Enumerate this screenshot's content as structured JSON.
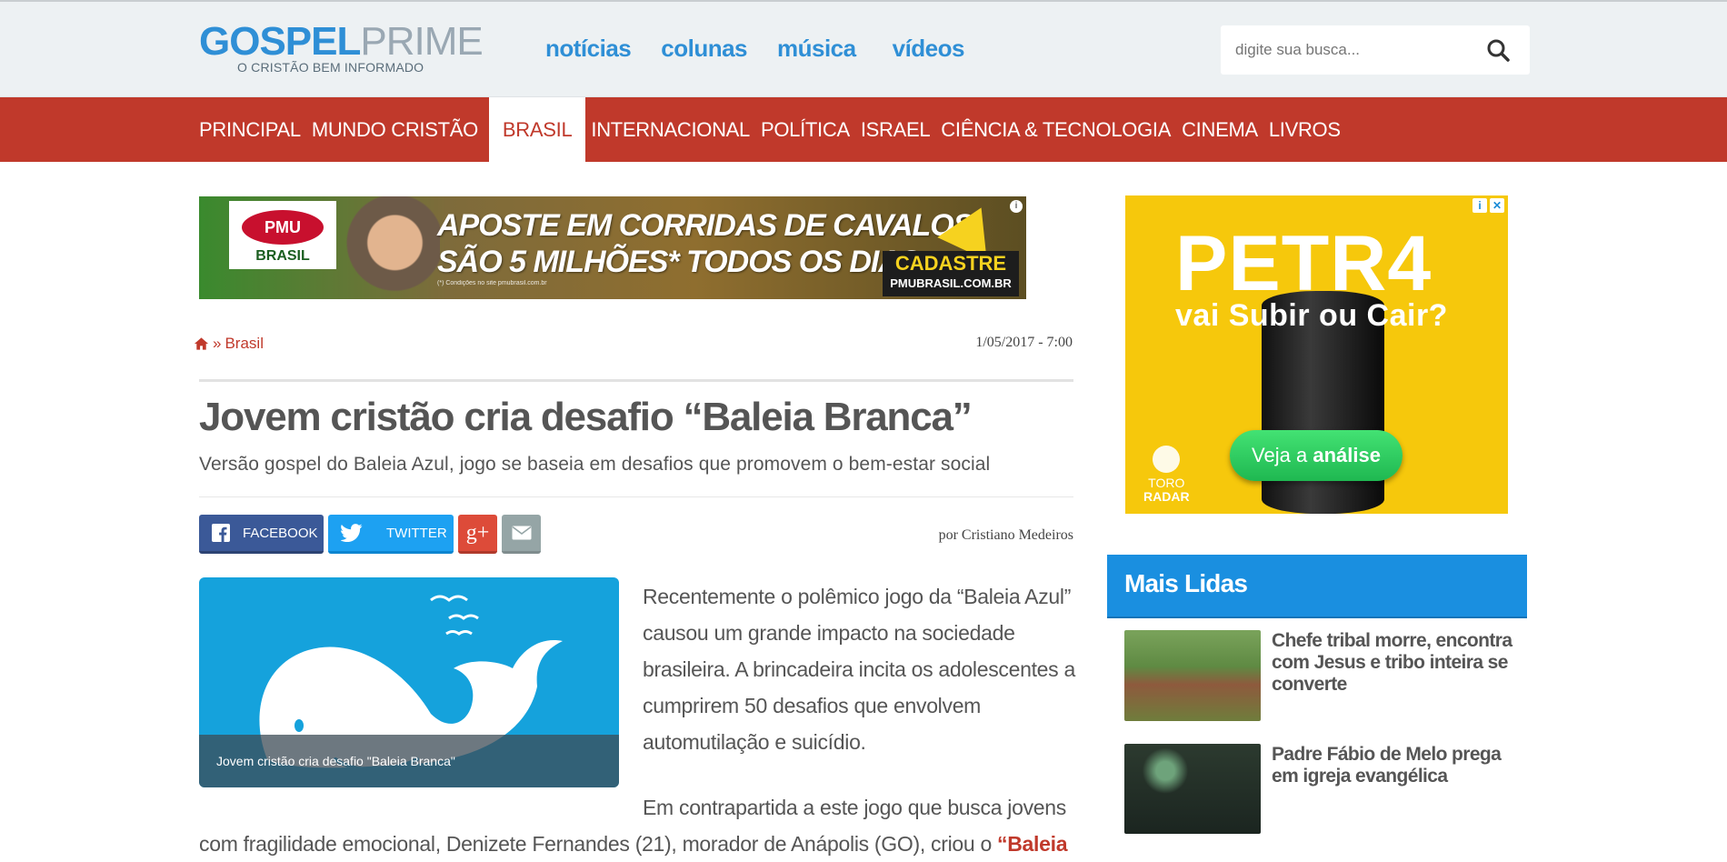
{
  "header": {
    "logo": {
      "word1": "GOSPEL",
      "word2": "PRIME",
      "tagline": "O CRISTÃO BEM INFORMADO"
    },
    "nav": [
      "notícias",
      "colunas",
      "música",
      "vídeos"
    ],
    "search": {
      "placeholder": "digite sua busca..."
    }
  },
  "categories": {
    "items": [
      "PRINCIPAL",
      "MUNDO CRISTÃO",
      "BRASIL",
      "INTERNACIONAL",
      "POLÍTICA",
      "ISRAEL",
      "CIÊNCIA & TECNOLOGIA",
      "CINEMA",
      "LIVROS"
    ],
    "active": "BRASIL"
  },
  "ad_top": {
    "brand": "PMU",
    "country": "BRASIL",
    "headline_line1": "APOSTE EM CORRIDAS DE CAVALOS",
    "headline_line2": "SÃO 5 MILHÕES* TODOS OS DIAS",
    "fine_print": "(*) Condições no site pmubrasil.com.br",
    "cta_label": "CADASTRE",
    "cta_url": "PMUBRASIL.COM.BR",
    "info": "i"
  },
  "breadcrumb": {
    "section": "Brasil",
    "separator": "»"
  },
  "article": {
    "date": "1/05/2017 - 7:00",
    "title": "Jovem cristão cria desafio “Baleia Branca”",
    "subtitle": "Versão gospel do Baleia Azul, jogo se baseia em desafios que promovem o bem-estar social",
    "author": "por Cristiano Medeiros",
    "share": {
      "facebook": "FACEBOOK",
      "twitter": "TWITTER",
      "google": "g+"
    },
    "image_caption": "Jovem cristão cria desafio \"Baleia Branca\"",
    "para1": "Recentemente o polêmico jogo da “Baleia Azul” causou um grande impacto na sociedade brasileira. A brincadeira incita os adolescentes a cumprirem 50 desafios que envolvem automutilação e suicídio.",
    "para2_line1": "Em contrapartida a este jogo que busca jovens",
    "para2_line2": "com fragilidade emocional, Denizete Fernandes (21), morador de Anápolis (GO), criou o ",
    "para2_link": "“Baleia"
  },
  "ad_side": {
    "ticker": "PETR4",
    "question": "vai Subir ou Cair?",
    "button_pre": "Veja a ",
    "button_bold": "análise",
    "brand_line1": "TORO",
    "brand_line2": "RADAR",
    "info": "i",
    "close": "✕"
  },
  "sidebar": {
    "most_read_title": "Mais Lidas",
    "items": [
      {
        "title": "Chefe tribal morre, encontra com Jesus e tribo inteira se converte"
      },
      {
        "title": "Padre Fábio de Melo prega em igreja evangélica"
      }
    ]
  },
  "colors": {
    "brand_red": "#c0392b",
    "brand_blue": "#2f8fd6",
    "sidebar_header": "#1a8fe0"
  }
}
